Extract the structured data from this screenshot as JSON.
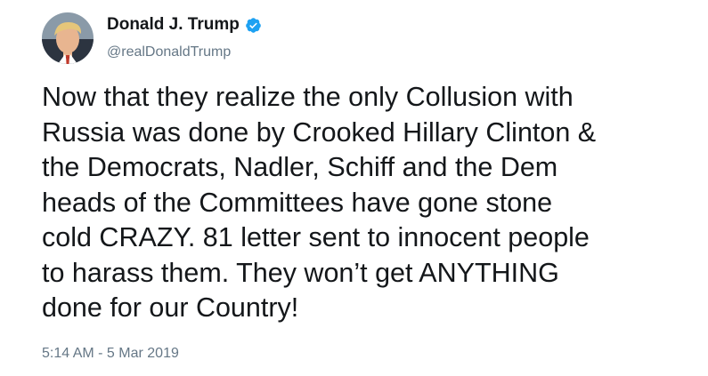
{
  "author": {
    "display_name": "Donald J. Trump",
    "handle": "@realDonaldTrump",
    "verified": true,
    "avatar_icon": "profile-photo"
  },
  "tweet": {
    "text": "Now that they realize the only Collusion with\nRussia was done by Crooked Hillary Clinton &\nthe Democrats, Nadler, Schiff and the Dem\nheads of the Committees have gone stone\ncold CRAZY. 81 letter sent to innocent people\nto harass them. They won’t get ANYTHING\ndone for our Country!",
    "timestamp": "5:14 AM - 5 Mar 2019"
  },
  "colors": {
    "text_primary": "#14171a",
    "text_secondary": "#657786",
    "verified_badge": "#1da1f2",
    "background": "#ffffff"
  }
}
